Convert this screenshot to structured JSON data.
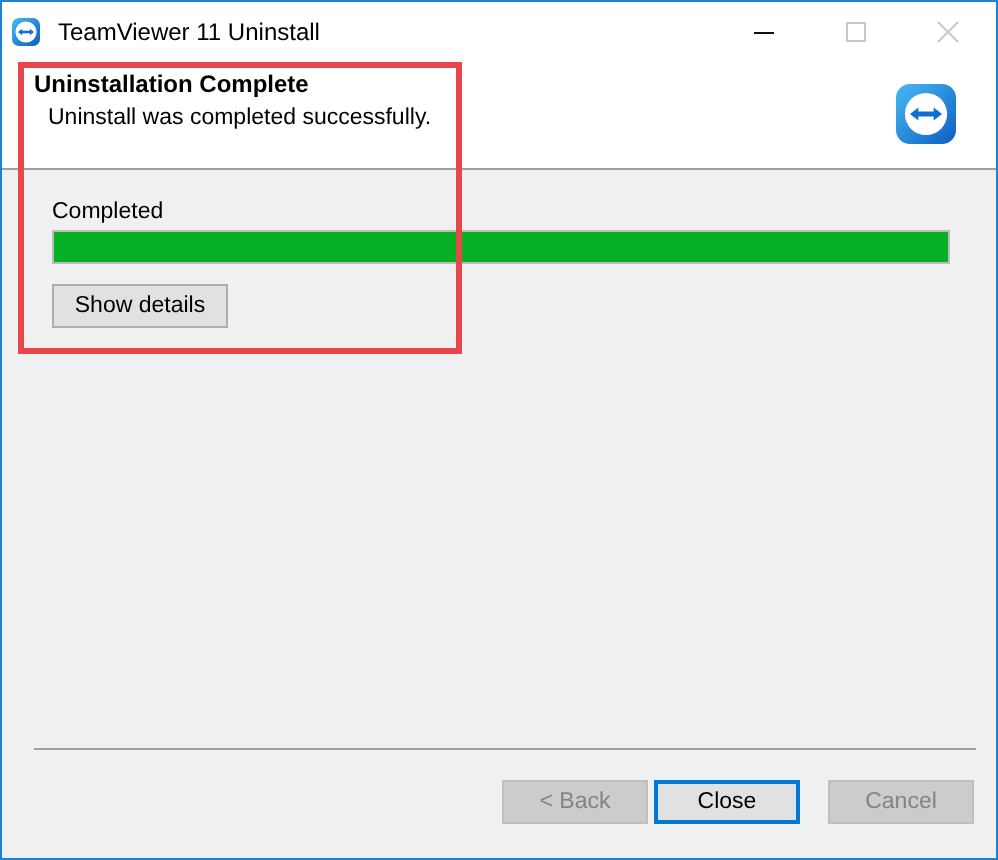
{
  "window": {
    "title": "TeamViewer 11 Uninstall",
    "controls": [
      {
        "kind": "minimize",
        "disabled": false
      },
      {
        "kind": "maximize",
        "disabled": true
      },
      {
        "kind": "close",
        "disabled": true
      }
    ]
  },
  "header": {
    "title": "Uninstallation Complete",
    "subtitle": "Uninstall was completed successfully."
  },
  "progress": {
    "label": "Completed",
    "level": 1
  },
  "details_button": {
    "label": "Show details"
  },
  "highlight": {
    "kind": "frame"
  },
  "buttons": [
    {
      "label": "< Back",
      "disabled": true,
      "selected": false
    },
    {
      "label": "Close",
      "disabled": false,
      "selected": true
    },
    {
      "label": "Cancel",
      "disabled": true,
      "selected": false
    }
  ]
}
